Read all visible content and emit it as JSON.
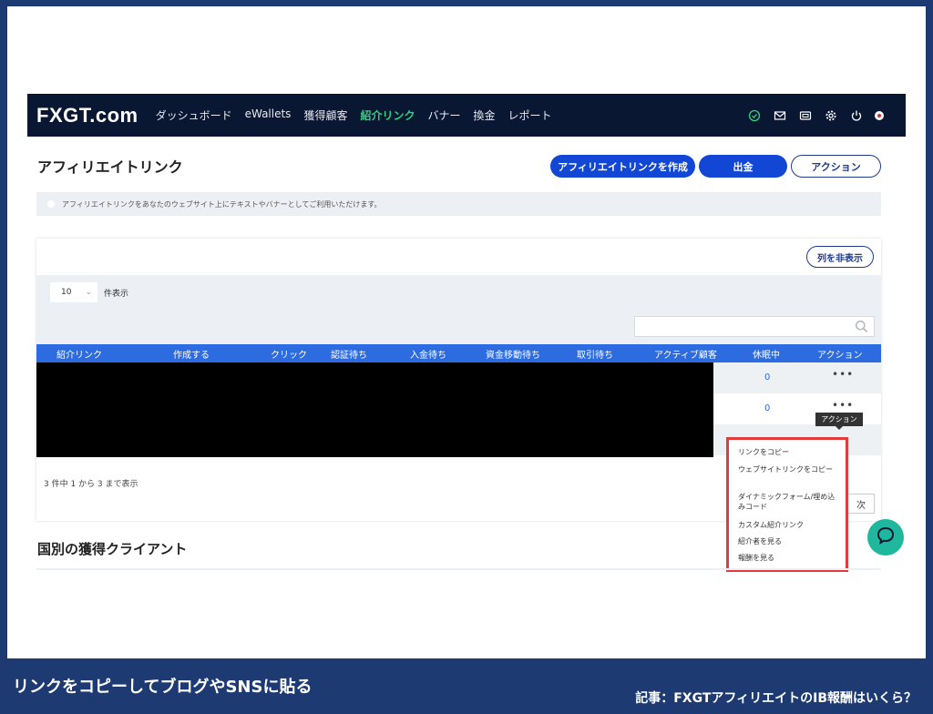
{
  "nav": {
    "logo": "FXGT.com",
    "items": [
      {
        "label": "ダッシュボード",
        "active": false
      },
      {
        "label": "eWallets",
        "active": false
      },
      {
        "label": "獲得顧客",
        "active": false
      },
      {
        "label": "紹介リンク",
        "active": true
      },
      {
        "label": "バナー",
        "active": false
      },
      {
        "label": "換金",
        "active": false
      },
      {
        "label": "レポート",
        "active": false
      }
    ],
    "icons": [
      "check-circle-icon",
      "mail-icon",
      "wallet-icon",
      "gear-icon",
      "power-icon",
      "flag-japan-icon"
    ]
  },
  "header": {
    "title": "アフィリエイトリンク",
    "create_button": "アフィリエイトリンクを作成",
    "withdraw_button": "出金",
    "action_button": "アクション"
  },
  "info": {
    "text": "アフィリエイトリンクをあなたのウェブサイト上にテキストやバナーとしてご利用いただけます。"
  },
  "table": {
    "hide_columns_button": "列を非表示",
    "per_page_value": "10",
    "per_page_label": "件表示",
    "search_placeholder": "",
    "columns": [
      "紹介リンク",
      "作成する",
      "クリック",
      "認証待ち",
      "入金待ち",
      "資金移動待ち",
      "取引待ち",
      "アクティブ顧客",
      "休眠中",
      "アクション"
    ],
    "rows": [
      {
        "dormant": "0",
        "action": "•••"
      },
      {
        "dormant": "0",
        "action": "•••"
      }
    ],
    "footer": "3 件中 1 から 3 まで表示",
    "next_button": "次"
  },
  "tooltip": "アクション",
  "dropdown": {
    "items": [
      "リンクをコピー",
      "ウェブサイトリンクをコピー",
      "ダイナミックフォーム/埋め込みコード",
      "カスタム紹介リンク",
      "紹介者を見る",
      "報酬を見る"
    ],
    "highlight_color": "#e23b3b"
  },
  "section": {
    "title": "国別の獲得クライアント"
  },
  "caption": {
    "left": "リンクをコピーしてブログやSNSに貼る",
    "right": "記事：FXGTアフィリエイトのIB報酬はいくら？"
  },
  "colors": {
    "nav_bg": "#0a1733",
    "active_nav": "#2fd27b",
    "primary": "#1247d6",
    "table_header": "#2d6be0",
    "banner_bg": "#1d3a72"
  }
}
